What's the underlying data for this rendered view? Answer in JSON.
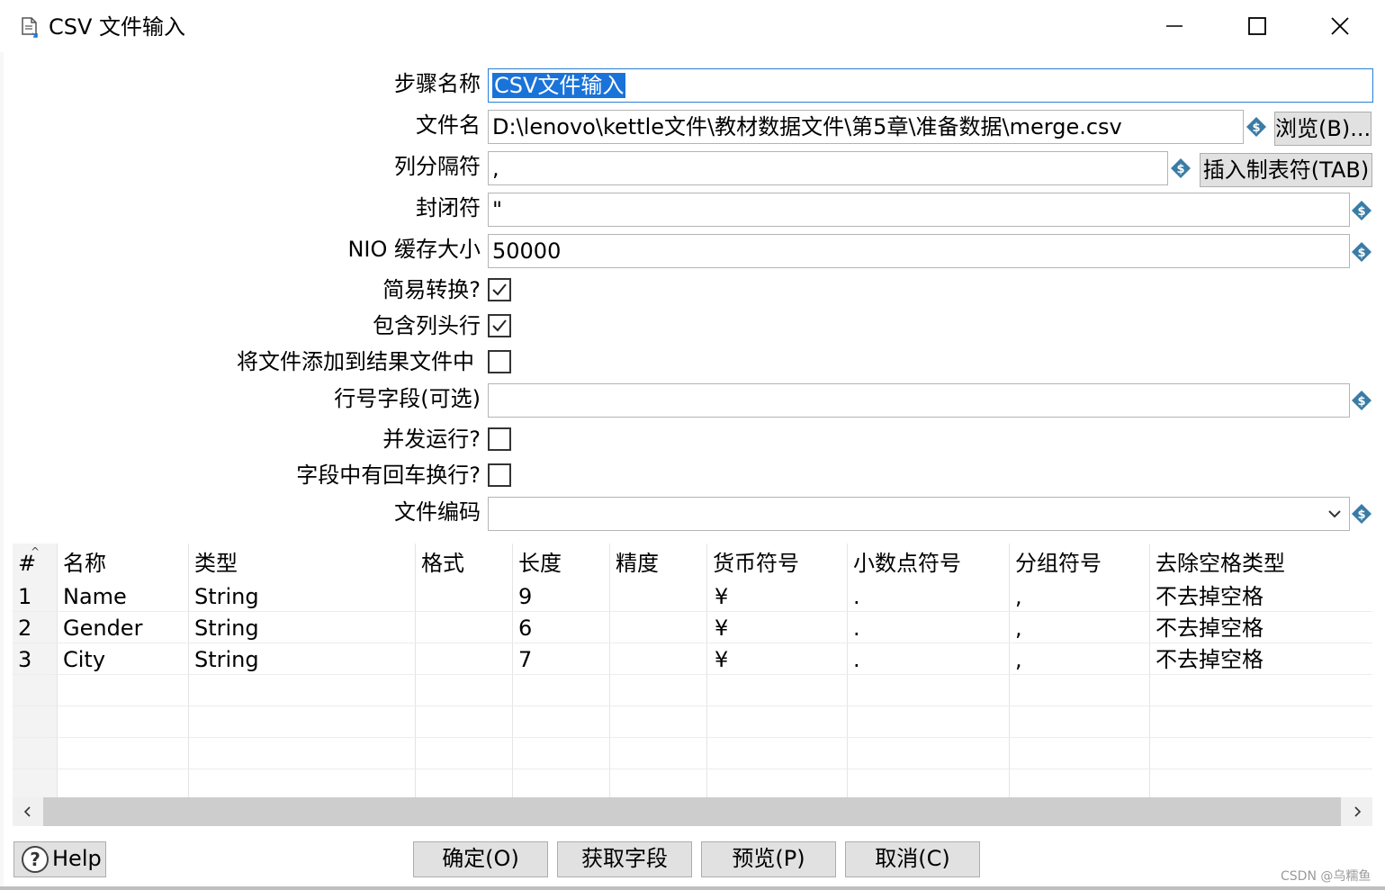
{
  "window": {
    "title": "CSV 文件输入",
    "icon": "document-icon",
    "controls": [
      "minimize-icon",
      "maximize-icon",
      "close-icon"
    ]
  },
  "form": {
    "step_name_label": "步骤名称",
    "step_name_value": "CSV文件输入",
    "filename_label": "文件名",
    "filename_value": "D:\\lenovo\\kettle文件\\教材数据文件\\第5章\\准备数据\\merge.csv",
    "browse_button": "浏览(B)...",
    "delimiter_label": "列分隔符",
    "delimiter_value": ",",
    "insert_tab_button": "插入制表符(TAB)",
    "enclosure_label": "封闭符",
    "enclosure_value": "\"",
    "nio_label": "NIO 缓存大小",
    "nio_value": "50000",
    "lazy_conversion_label": "简易转换?",
    "lazy_conversion_checked": true,
    "header_row_label": "包含列头行",
    "header_row_checked": true,
    "add_to_result_label": "将文件添加到结果文件中",
    "add_to_result_checked": false,
    "row_number_label": "行号字段(可选)",
    "row_number_value": "",
    "parallel_label": "并发运行?",
    "parallel_checked": false,
    "newline_label": "字段中有回车换行?",
    "newline_checked": false,
    "encoding_label": "文件编码",
    "encoding_value": ""
  },
  "table": {
    "headers": [
      "#",
      "名称",
      "类型",
      "格式",
      "长度",
      "精度",
      "货币符号",
      "小数点符号",
      "分组符号",
      "去除空格类型"
    ],
    "rows": [
      {
        "num": "1",
        "name": "Name",
        "type": "String",
        "format": "",
        "length": "9",
        "precision": "",
        "currency": "¥",
        "decimal": ".",
        "group": ",",
        "trim": "不去掉空格"
      },
      {
        "num": "2",
        "name": "Gender",
        "type": "String",
        "format": "",
        "length": "6",
        "precision": "",
        "currency": "¥",
        "decimal": ".",
        "group": ",",
        "trim": "不去掉空格"
      },
      {
        "num": "3",
        "name": "City",
        "type": "String",
        "format": "",
        "length": "7",
        "precision": "",
        "currency": "¥",
        "decimal": ".",
        "group": ",",
        "trim": "不去掉空格"
      }
    ]
  },
  "buttons": {
    "help": "Help",
    "ok": "确定(O)",
    "get_fields": "获取字段",
    "preview": "预览(P)",
    "cancel": "取消(C)"
  },
  "watermark": "CSDN @乌糯鱼",
  "colors": {
    "selection": "#1a73d9",
    "button_bg": "#e1e1e1",
    "variable_icon": "#3a7ca5"
  }
}
